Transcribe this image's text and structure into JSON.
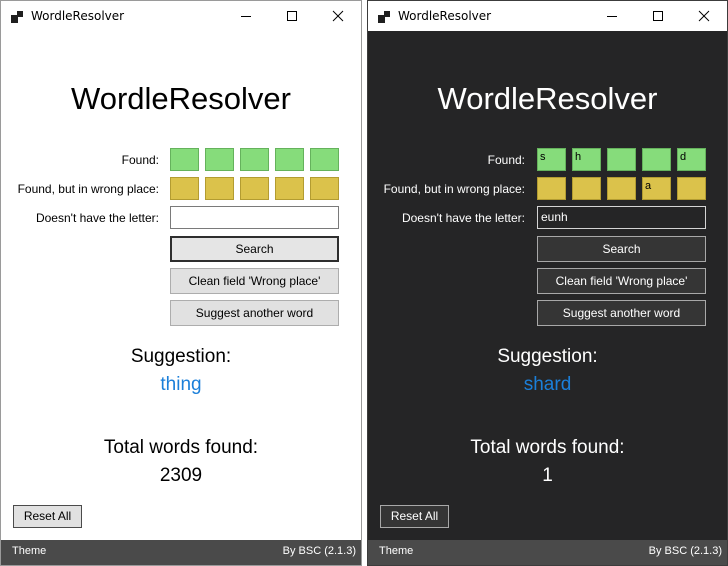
{
  "windows": [
    {
      "theme": "light",
      "window_title": "WordleResolver",
      "app_title": "WordleResolver",
      "labels": {
        "found": "Found:",
        "wrong_place": "Found, but in wrong place:",
        "doesnt_have": "Doesn't have the letter:"
      },
      "found_cells": [
        "",
        "",
        "",
        "",
        ""
      ],
      "wrong_place_cells": [
        "",
        "",
        "",
        "",
        ""
      ],
      "excluded_letters": "",
      "buttons": {
        "search": "Search",
        "clean": "Clean field 'Wrong place'",
        "suggest": "Suggest another word",
        "reset": "Reset All"
      },
      "suggestion_label": "Suggestion:",
      "suggestion_word": "thing",
      "total_label": "Total words found:",
      "total_value": "2309",
      "status": {
        "theme": "Theme",
        "version": "By BSC (2.1.3)"
      }
    },
    {
      "theme": "dark",
      "window_title": "WordleResolver",
      "app_title": "WordleResolver",
      "labels": {
        "found": "Found:",
        "wrong_place": "Found, but in wrong place:",
        "doesnt_have": "Doesn't have the letter:"
      },
      "found_cells": [
        "s",
        "h",
        "",
        "",
        "d"
      ],
      "wrong_place_cells": [
        "",
        "",
        "",
        "a",
        ""
      ],
      "excluded_letters": "eunh",
      "buttons": {
        "search": "Search",
        "clean": "Clean field 'Wrong place'",
        "suggest": "Suggest another word",
        "reset": "Reset All"
      },
      "suggestion_label": "Suggestion:",
      "suggestion_word": "shard",
      "total_label": "Total words found:",
      "total_value": "1",
      "status": {
        "theme": "Theme",
        "version": "By BSC (2.1.3)"
      }
    }
  ],
  "icons": [
    "app-icon",
    "minimize-icon",
    "maximize-icon",
    "close-icon"
  ],
  "colors": {
    "found_green": "#86dc7b",
    "wrong_place_yellow": "#dbc24b",
    "suggestion_blue": "#1b7fd9",
    "dark_background": "#252526",
    "status_bar": "#4a4a4a"
  }
}
